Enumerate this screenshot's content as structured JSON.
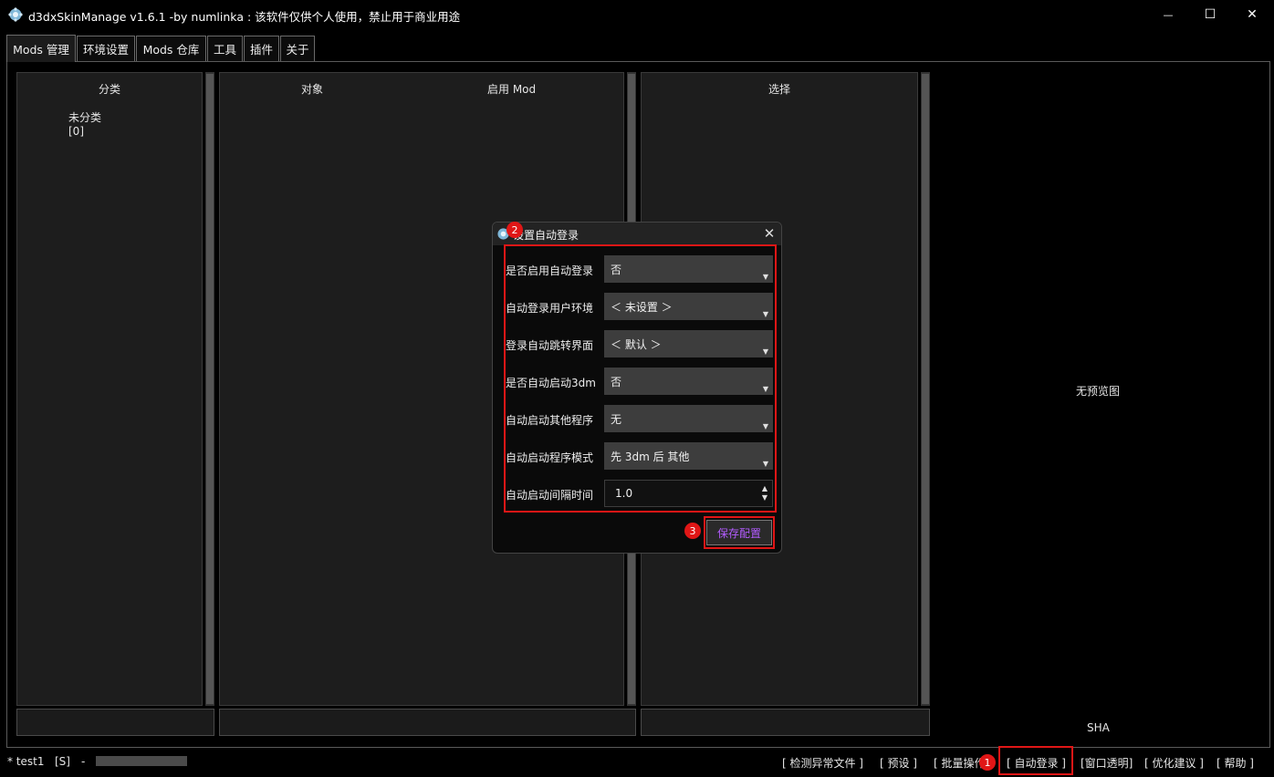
{
  "window": {
    "title": "d3dxSkinManage v1.6.1 -by numlinka : 该软件仅供个人使用，禁止用于商业用途",
    "minimize_glyph": "—",
    "maximize_glyph": "☐",
    "close_glyph": "✕"
  },
  "tabs": [
    {
      "label": "Mods 管理",
      "active": true
    },
    {
      "label": "环境设置"
    },
    {
      "label": "Mods 仓库"
    },
    {
      "label": "工具"
    },
    {
      "label": "插件"
    },
    {
      "label": "关于"
    }
  ],
  "category_panel": {
    "header": "分类",
    "items": [
      {
        "name": "未分类",
        "count": "[0]"
      }
    ]
  },
  "object_panel": {
    "header_object": "对象",
    "header_enable": "启用 Mod"
  },
  "select_panel": {
    "header": "选择"
  },
  "preview": {
    "no_preview": "无预览图",
    "sha": "SHA"
  },
  "status_bar": {
    "env": "* test1",
    "flag": "[S]",
    "dash": "-",
    "links": {
      "detect": "[ 检测异常文件 ]",
      "preset": "[ 预设 ]",
      "batch": "[ 批量操作",
      "autologin": "[ 自动登录 ]",
      "transparency": "[窗口透明]",
      "suggest": "[ 优化建议 ]",
      "help": "[ 帮助 ]"
    }
  },
  "dialog": {
    "title": "设置自动登录",
    "close_glyph": "✕",
    "fields": [
      {
        "label": "是否启用自动登录",
        "value": "否"
      },
      {
        "label": "自动登录用户环境",
        "value": "＜ 未设置 ＞"
      },
      {
        "label": "登录自动跳转界面",
        "value": "＜ 默认 ＞"
      },
      {
        "label": "是否自动启动3dm",
        "value": "否"
      },
      {
        "label": "自动启动其他程序",
        "value": "无"
      },
      {
        "label": "自动启动程序模式",
        "value": "先 3dm 后 其他"
      },
      {
        "label": "自动启动间隔时间",
        "value": "1.0"
      }
    ],
    "save_label": "保存配置"
  },
  "annotations": {
    "m1": "1",
    "m2": "2",
    "m3": "3",
    "color": "#e01616"
  },
  "icons": {
    "app": "gear-snowflake-icon",
    "dropdown": "triangle-down-icon",
    "spin": "spin-arrows-icon"
  },
  "colors": {
    "background": "#000000",
    "panel": "#1d1d1d",
    "accent_save": "#b35cff"
  }
}
